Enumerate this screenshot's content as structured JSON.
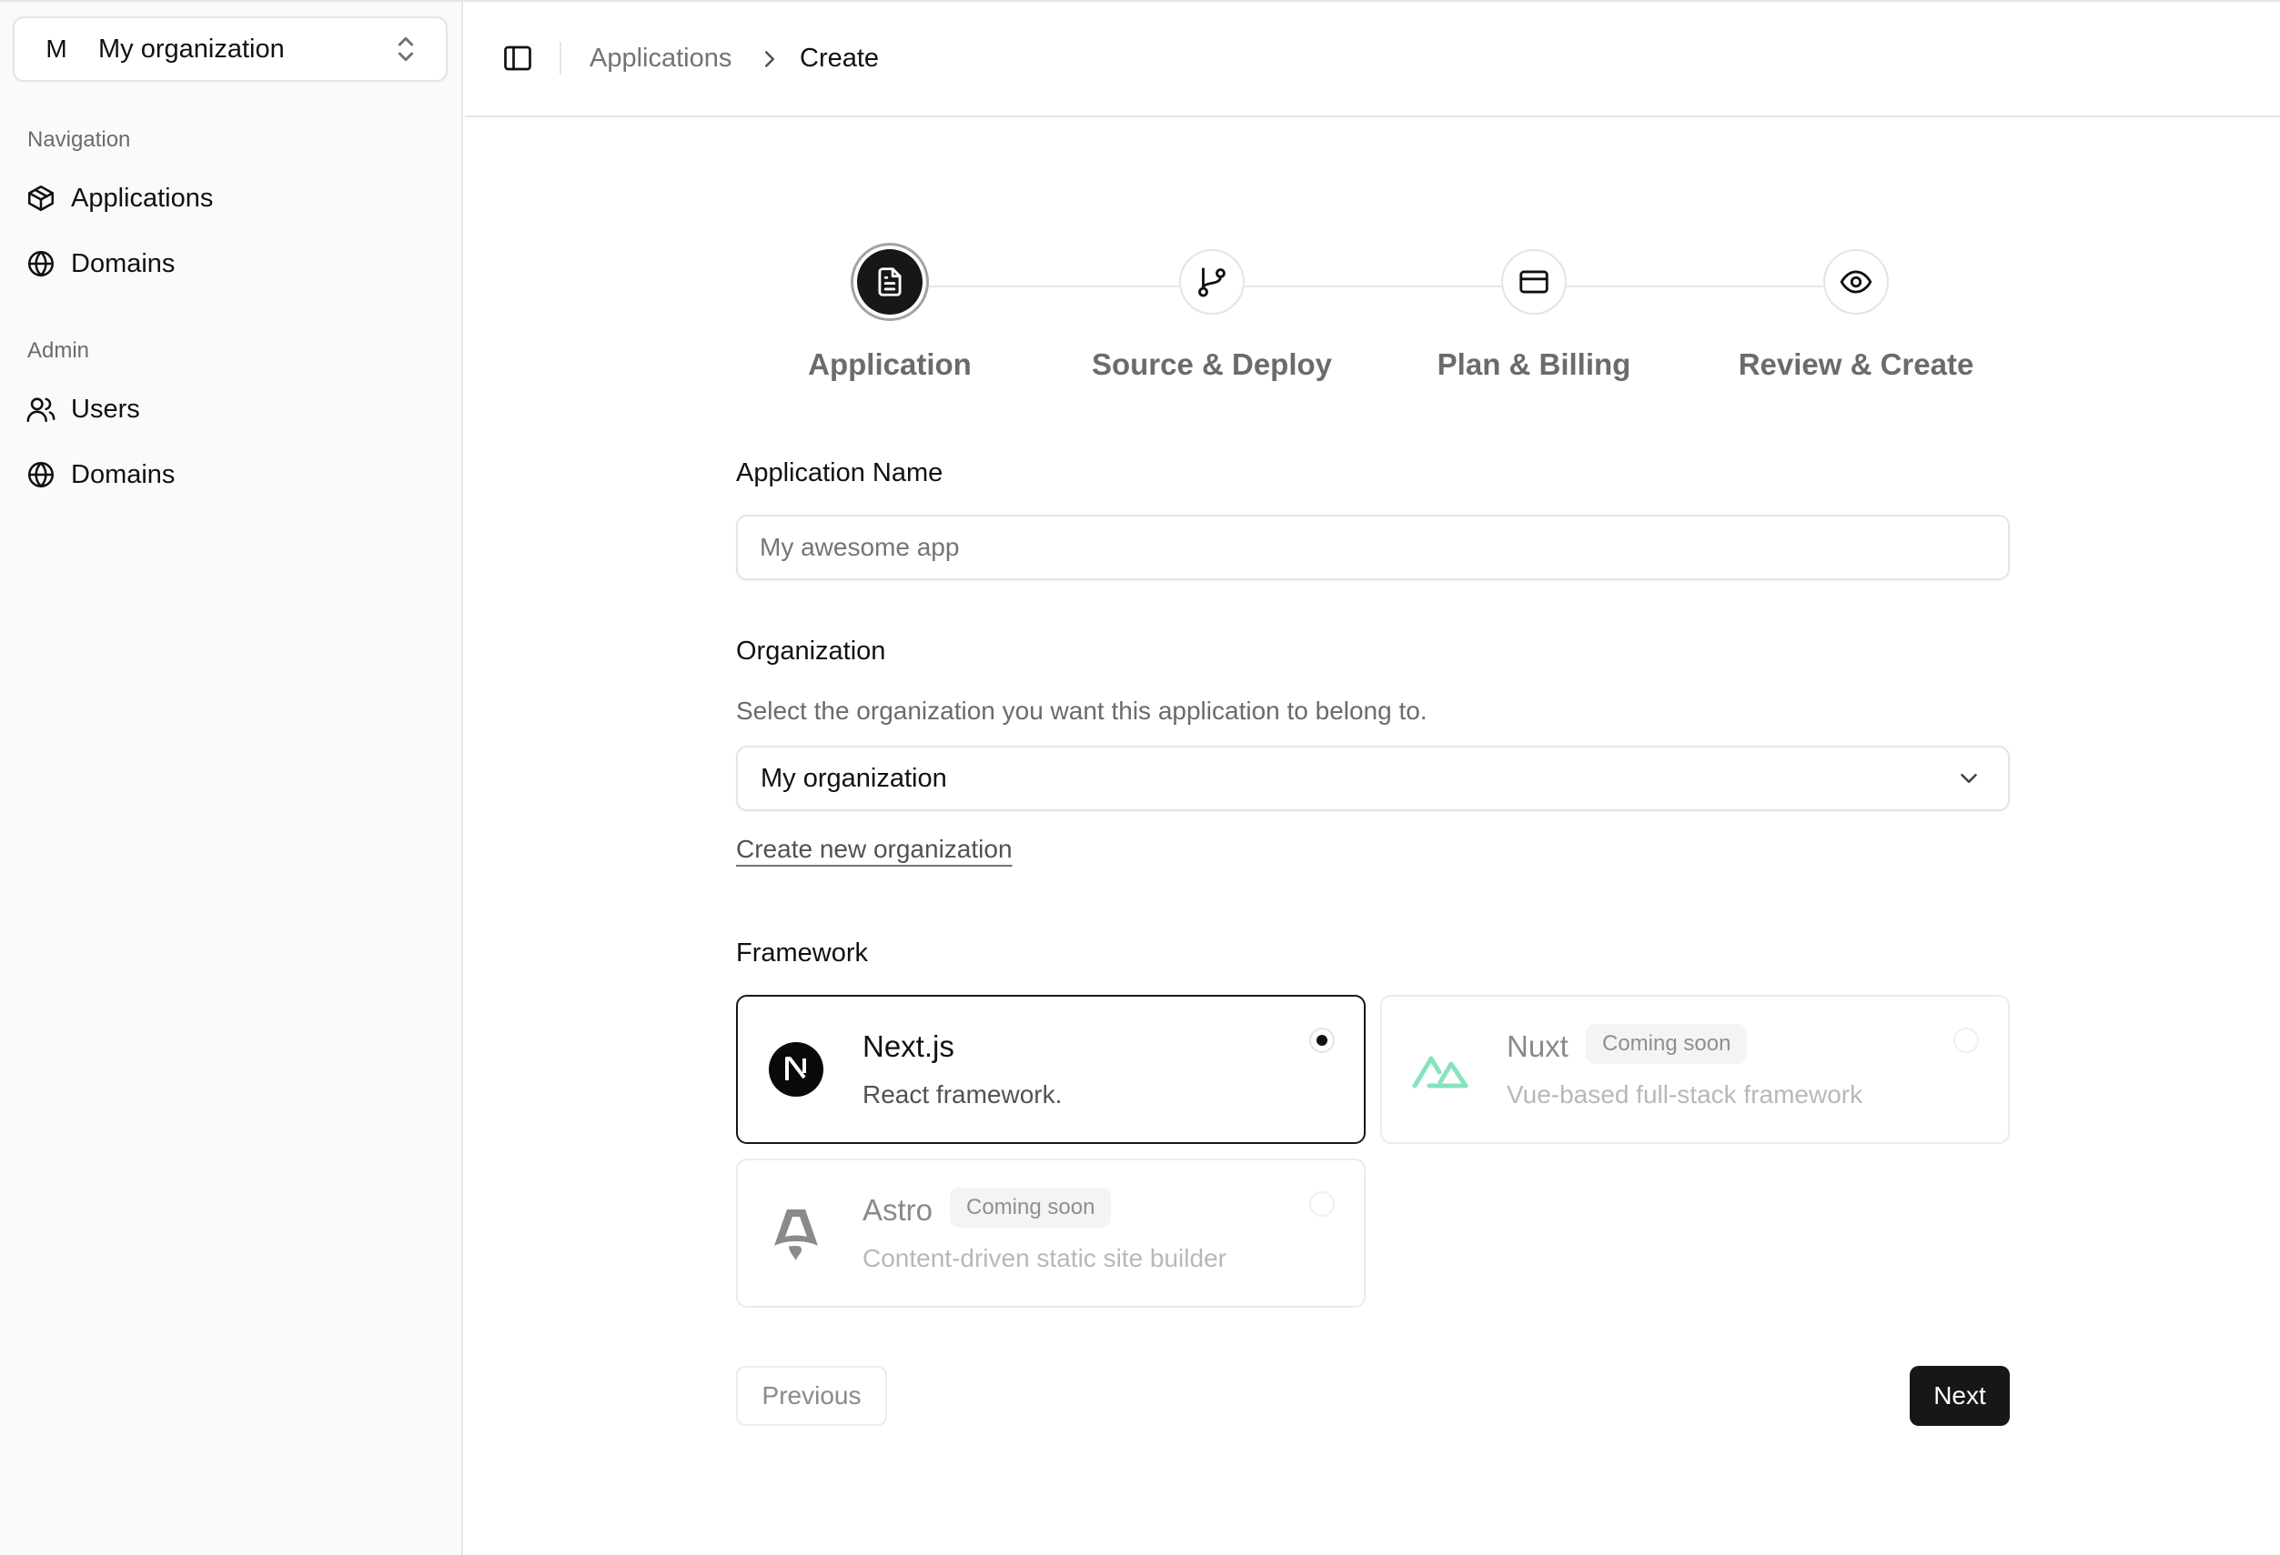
{
  "sidebar": {
    "org_switcher": {
      "initial": "M",
      "name": "My organization"
    },
    "groups": [
      {
        "label": "Navigation",
        "items": [
          {
            "label": "Applications",
            "icon": "package-icon"
          },
          {
            "label": "Domains",
            "icon": "globe-icon"
          }
        ]
      },
      {
        "label": "Admin",
        "items": [
          {
            "label": "Users",
            "icon": "users-icon"
          },
          {
            "label": "Domains",
            "icon": "globe-icon"
          }
        ]
      }
    ]
  },
  "header": {
    "breadcrumb": {
      "parent": "Applications",
      "current": "Create"
    }
  },
  "stepper": {
    "steps": [
      {
        "label": "Application",
        "icon": "file-text-icon",
        "active": true
      },
      {
        "label": "Source & Deploy",
        "icon": "git-branch-icon",
        "active": false
      },
      {
        "label": "Plan & Billing",
        "icon": "credit-card-icon",
        "active": false
      },
      {
        "label": "Review & Create",
        "icon": "eye-icon",
        "active": false
      }
    ]
  },
  "form": {
    "app_name": {
      "label": "Application Name",
      "placeholder": "My awesome app",
      "value": ""
    },
    "organization": {
      "label": "Organization",
      "helper": "Select the organization you want this application to belong to.",
      "selected": "My organization",
      "create_link": "Create new organization"
    },
    "framework": {
      "label": "Framework",
      "options": [
        {
          "name": "Next.js",
          "description": "React framework.",
          "badge": "",
          "selected": true,
          "disabled": false
        },
        {
          "name": "Nuxt",
          "description": "Vue-based full-stack framework",
          "badge": "Coming soon",
          "selected": false,
          "disabled": true
        },
        {
          "name": "Astro",
          "description": "Content-driven static site builder",
          "badge": "Coming soon",
          "selected": false,
          "disabled": true
        }
      ]
    }
  },
  "actions": {
    "previous": "Previous",
    "next": "Next"
  },
  "colors": {
    "primary": "#171717",
    "nuxt_green": "#86e3be",
    "border": "#e4e4e7",
    "muted_text": "#6b6b6b"
  }
}
